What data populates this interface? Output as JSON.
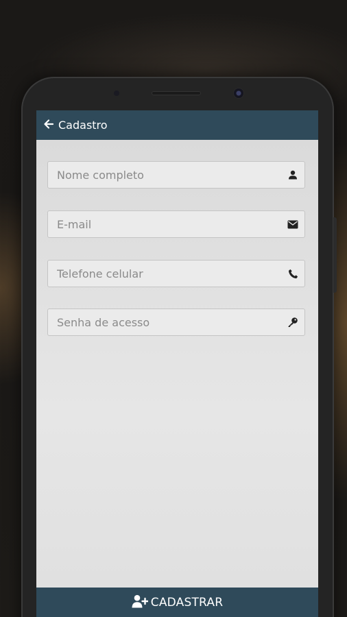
{
  "appbar": {
    "title": "Cadastro",
    "back_icon": "arrow-left-icon"
  },
  "form": {
    "fields": [
      {
        "placeholder": "Nome completo",
        "value": "",
        "icon": "user-icon"
      },
      {
        "placeholder": "E-mail",
        "value": "",
        "icon": "envelope-icon"
      },
      {
        "placeholder": "Telefone celular",
        "value": "",
        "icon": "phone-icon"
      },
      {
        "placeholder": "Senha de acesso",
        "value": "",
        "icon": "key-icon"
      }
    ]
  },
  "footer": {
    "button_label": "CADASTRAR",
    "button_icon": "user-plus-icon"
  },
  "colors": {
    "primary": "#2f4a5a",
    "screen_background": "#e2e2e2",
    "field_background": "#ebebeb",
    "field_border": "#c4c4c4",
    "placeholder_text": "#8a8a8a"
  }
}
